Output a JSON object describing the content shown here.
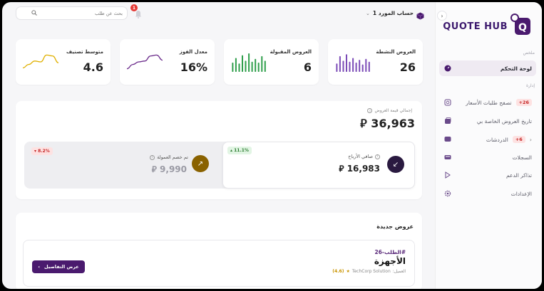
{
  "account": {
    "name": "حساب المورد 1",
    "chevron": "chevron-down-icon"
  },
  "search": {
    "placeholder": "بحث عن طلب"
  },
  "notifications": {
    "count": "1"
  },
  "brand": {
    "logo_text": "QUOTE HUB",
    "logo_letter": "Q",
    "accent": "#4a1a6e"
  },
  "sidebar": {
    "section_summary": "ملخص",
    "section_manage": "إدارة",
    "items": [
      {
        "label": "لوحة التحكم",
        "icon": "dashboard-icon",
        "active": true
      },
      {
        "label": "تصفح طلبات الأسعار",
        "icon": "search-doc-icon",
        "badge": "26+"
      },
      {
        "label": "تاريخ العروض الخاصة بي",
        "icon": "history-icon"
      },
      {
        "label": "الدردشات",
        "icon": "chat-icon",
        "badge": "6+"
      },
      {
        "label": "السجلات",
        "icon": "records-icon"
      },
      {
        "label": "تذاكر الدعم",
        "icon": "support-icon"
      },
      {
        "label": "الإعدادات",
        "icon": "settings-icon"
      }
    ]
  },
  "stats": [
    {
      "title": "العروض النشطة",
      "value": "26",
      "chart": "bars",
      "color": "#7b4bb7",
      "bars": [
        0.45,
        0.85,
        0.6,
        0.95,
        0.55,
        0.75,
        0.5,
        0.65,
        0.4,
        0.7,
        0.55
      ]
    },
    {
      "title": "العروض المقبولة",
      "value": "6",
      "chart": "bars",
      "color": "#2e9e4a",
      "bars": [
        0.5,
        0.75,
        0.45,
        0.9,
        0.6,
        1.0,
        0.55,
        0.7,
        0.5,
        0.85,
        0.6
      ]
    },
    {
      "title": "معدل الفوز",
      "value": "16%",
      "chart": "line",
      "color": "#6a2a8a",
      "line": [
        0.1,
        0.35,
        0.5,
        0.55,
        0.85,
        0.9,
        0.6
      ]
    },
    {
      "title": "متوسط تصنيف",
      "value": "4.6",
      "chart": "line",
      "color": "#e0b000",
      "line": [
        0.15,
        0.35,
        0.55,
        0.5,
        0.9,
        0.85,
        0.45
      ]
    }
  ],
  "totals": {
    "label": "إجمالي قيمة العروض",
    "value": "36,963",
    "net_profit": {
      "label": "صافي الأرباح",
      "value": "16,983",
      "change": "11.1%",
      "arrow": "arrow-down-left-icon"
    },
    "commission": {
      "label": "تم خصم العمولة",
      "value": "9,990",
      "change": "8.2%",
      "arrow": "arrow-up-right-icon"
    }
  },
  "new_offers": {
    "title": "عروض جديدة",
    "items": [
      {
        "ref": "#الطلب-26",
        "category": "الأجهزة",
        "client_label": "العميل:",
        "client": "TechCorp Solution",
        "rating": "(4.6)",
        "action": "عرض التفاصيل"
      }
    ]
  }
}
